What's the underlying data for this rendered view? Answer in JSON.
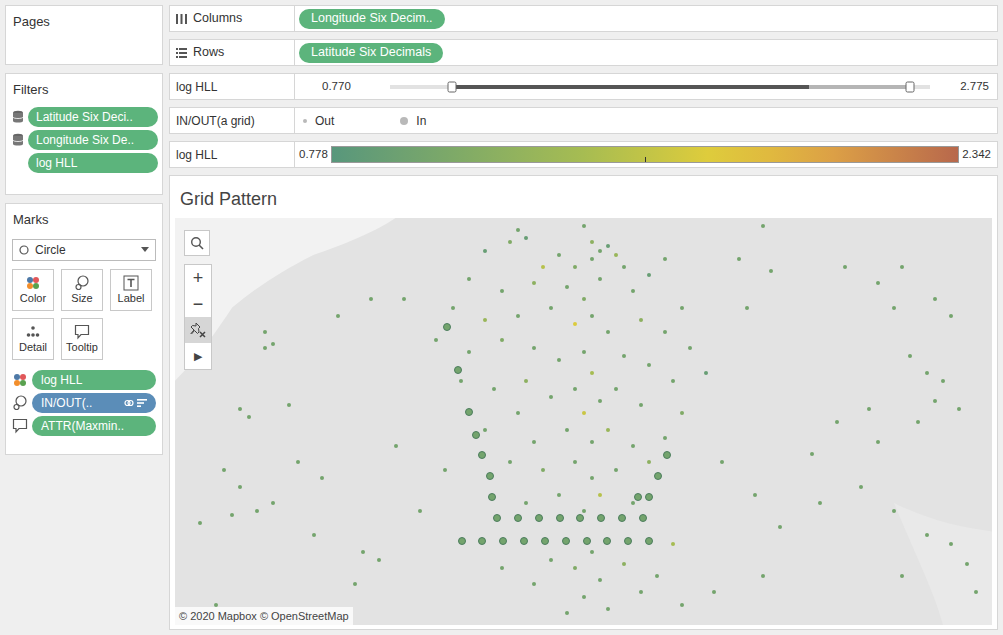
{
  "pages_panel": {
    "title": "Pages"
  },
  "filters_panel": {
    "title": "Filters",
    "items": [
      {
        "label": "Latitude Six Deci..",
        "kind": "db"
      },
      {
        "label": "Longitude Six De..",
        "kind": "db"
      },
      {
        "label": "log HLL",
        "kind": "plain"
      }
    ]
  },
  "marks_panel": {
    "title": "Marks",
    "mark_type": "Circle",
    "buttons": [
      {
        "label": "Color",
        "kind": "color"
      },
      {
        "label": "Size",
        "kind": "size"
      },
      {
        "label": "Label",
        "kind": "label"
      },
      {
        "label": "Detail",
        "kind": "detail"
      },
      {
        "label": "Tooltip",
        "kind": "tooltip"
      }
    ],
    "pills": [
      {
        "label": "log HLL",
        "kind": "color",
        "color": "#5cb47c"
      },
      {
        "label": "IN/OUT(..",
        "kind": "size",
        "color": "#5b8db8"
      },
      {
        "label": "ATTR(Maxmin..",
        "kind": "tooltip",
        "color": "#5cb47c"
      }
    ]
  },
  "shelves": {
    "columns": {
      "title": "Columns",
      "pill": "Longitude Six Decim.."
    },
    "rows": {
      "title": "Rows",
      "pill": "Latitude Six Decimals"
    }
  },
  "filter_card": {
    "title": "log HLL",
    "min": "0.770",
    "max": "2.775",
    "level_low": 0.115,
    "data_high": 0.775,
    "level_high": 0.963
  },
  "size_legend": {
    "title": "IN/OUT(a grid)",
    "items": [
      {
        "label": "Out",
        "kind": "small"
      },
      {
        "label": "In",
        "kind": "large"
      }
    ]
  },
  "color_legend": {
    "title": "log HLL",
    "min": "0.778",
    "max": "2.342",
    "marker_level": 0.5
  },
  "viz": {
    "title": "Grid Pattern",
    "attribution": "© 2020 Mapbox © OpenStreetMap",
    "toolbar": [
      {
        "kind": "search",
        "selected": false
      },
      {
        "kind": "zoom-in",
        "glyph": "+",
        "selected": false
      },
      {
        "kind": "zoom-out",
        "glyph": "−",
        "selected": false
      },
      {
        "kind": "clear-pins",
        "selected": true
      },
      {
        "kind": "expand",
        "glyph": "▶",
        "selected": false
      }
    ],
    "points": [
      [
        0.42,
        0.03,
        1.0
      ],
      [
        0.43,
        0.05,
        0.9
      ],
      [
        0.41,
        0.06,
        1.1
      ],
      [
        0.5,
        0.02,
        1.0
      ],
      [
        0.51,
        0.06,
        1.2
      ],
      [
        0.52,
        0.08,
        1.0
      ],
      [
        0.53,
        0.07,
        0.9
      ],
      [
        0.54,
        0.09,
        1.3
      ],
      [
        0.51,
        0.1,
        1.0
      ],
      [
        0.49,
        0.12,
        1.1
      ],
      [
        0.55,
        0.12,
        1.0
      ],
      [
        0.47,
        0.09,
        1.0
      ],
      [
        0.45,
        0.12,
        1.5
      ],
      [
        0.38,
        0.08,
        0.9
      ],
      [
        0.36,
        0.15,
        1.0
      ],
      [
        0.4,
        0.18,
        1.0
      ],
      [
        0.44,
        0.16,
        1.2
      ],
      [
        0.48,
        0.17,
        1.0
      ],
      [
        0.52,
        0.15,
        1.0
      ],
      [
        0.5,
        0.2,
        1.1
      ],
      [
        0.56,
        0.18,
        1.0
      ],
      [
        0.58,
        0.14,
        0.9
      ],
      [
        0.6,
        0.1,
        1.0
      ],
      [
        0.62,
        0.22,
        1.0
      ],
      [
        0.34,
        0.22,
        1.0
      ],
      [
        0.38,
        0.25,
        1.3
      ],
      [
        0.42,
        0.24,
        1.0
      ],
      [
        0.46,
        0.22,
        1.0
      ],
      [
        0.49,
        0.26,
        1.7
      ],
      [
        0.51,
        0.24,
        1.0
      ],
      [
        0.53,
        0.28,
        1.0
      ],
      [
        0.57,
        0.25,
        1.2
      ],
      [
        0.6,
        0.28,
        1.0
      ],
      [
        0.63,
        0.32,
        1.0
      ],
      [
        0.32,
        0.3,
        1.0
      ],
      [
        0.36,
        0.33,
        1.0
      ],
      [
        0.4,
        0.3,
        1.1
      ],
      [
        0.44,
        0.32,
        1.0
      ],
      [
        0.47,
        0.35,
        1.0
      ],
      [
        0.5,
        0.33,
        1.0
      ],
      [
        0.51,
        0.38,
        1.4
      ],
      [
        0.55,
        0.34,
        1.0
      ],
      [
        0.58,
        0.36,
        1.0
      ],
      [
        0.61,
        0.4,
        1.0
      ],
      [
        0.65,
        0.38,
        0.9
      ],
      [
        0.35,
        0.4,
        1.0
      ],
      [
        0.39,
        0.42,
        1.0
      ],
      [
        0.43,
        0.4,
        1.2
      ],
      [
        0.46,
        0.44,
        1.0
      ],
      [
        0.49,
        0.42,
        1.0
      ],
      [
        0.52,
        0.45,
        1.0
      ],
      [
        0.5,
        0.48,
        1.6
      ],
      [
        0.54,
        0.42,
        1.0
      ],
      [
        0.57,
        0.46,
        1.0
      ],
      [
        0.62,
        0.48,
        1.1
      ],
      [
        0.42,
        0.48,
        1.0
      ],
      [
        0.38,
        0.52,
        1.0
      ],
      [
        0.44,
        0.55,
        1.0
      ],
      [
        0.48,
        0.52,
        1.0
      ],
      [
        0.51,
        0.55,
        1.0
      ],
      [
        0.53,
        0.52,
        1.3
      ],
      [
        0.56,
        0.56,
        1.0
      ],
      [
        0.6,
        0.54,
        1.0
      ],
      [
        0.41,
        0.6,
        1.0
      ],
      [
        0.45,
        0.62,
        1.1
      ],
      [
        0.49,
        0.6,
        1.0
      ],
      [
        0.51,
        0.64,
        1.0
      ],
      [
        0.54,
        0.62,
        1.0
      ],
      [
        0.58,
        0.6,
        1.2
      ],
      [
        0.52,
        0.68,
        1.5
      ],
      [
        0.47,
        0.68,
        1.0
      ],
      [
        0.43,
        0.7,
        1.0
      ],
      [
        0.56,
        0.7,
        1.0
      ],
      [
        0.5,
        0.72,
        1.0
      ],
      [
        0.51,
        0.82,
        1.0
      ],
      [
        0.49,
        0.86,
        1.1
      ],
      [
        0.52,
        0.89,
        1.0
      ],
      [
        0.5,
        0.93,
        1.0
      ],
      [
        0.53,
        0.96,
        1.0
      ],
      [
        0.46,
        0.84,
        1.0
      ],
      [
        0.55,
        0.85,
        1.2
      ],
      [
        0.44,
        0.9,
        1.0
      ],
      [
        0.57,
        0.92,
        1.0
      ],
      [
        0.48,
        0.97,
        1.0
      ],
      [
        0.61,
        0.8,
        1.4
      ],
      [
        0.59,
        0.88,
        1.0
      ],
      [
        0.4,
        0.86,
        1.0
      ],
      [
        0.62,
        0.95,
        1.0
      ],
      [
        0.33,
        0.62,
        1.0
      ],
      [
        0.3,
        0.72,
        1.0
      ],
      [
        0.27,
        0.56,
        1.0
      ],
      [
        0.24,
        0.2,
        1.0
      ],
      [
        0.11,
        0.28,
        1.0
      ],
      [
        0.12,
        0.31,
        1.0
      ],
      [
        0.11,
        0.32,
        1.0
      ],
      [
        0.08,
        0.47,
        1.0
      ],
      [
        0.09,
        0.49,
        1.0
      ],
      [
        0.14,
        0.46,
        1.0
      ],
      [
        0.06,
        0.62,
        1.0
      ],
      [
        0.08,
        0.66,
        1.0
      ],
      [
        0.1,
        0.72,
        1.0
      ],
      [
        0.12,
        0.7,
        1.0
      ],
      [
        0.07,
        0.73,
        1.0
      ],
      [
        0.15,
        0.6,
        1.0
      ],
      [
        0.18,
        0.64,
        1.0
      ],
      [
        0.17,
        0.78,
        1.0
      ],
      [
        0.23,
        0.82,
        1.0
      ],
      [
        0.25,
        0.84,
        1.0
      ],
      [
        0.03,
        0.75,
        1.0
      ],
      [
        0.2,
        0.24,
        1.0
      ],
      [
        0.28,
        0.2,
        1.0
      ],
      [
        0.22,
        0.9,
        1.0
      ],
      [
        0.05,
        0.95,
        1.0
      ],
      [
        0.69,
        0.1,
        1.0
      ],
      [
        0.72,
        0.02,
        1.0
      ],
      [
        0.73,
        0.13,
        1.0
      ],
      [
        0.7,
        0.22,
        1.0
      ],
      [
        0.82,
        0.12,
        1.0
      ],
      [
        0.86,
        0.16,
        1.0
      ],
      [
        0.89,
        0.12,
        1.0
      ],
      [
        0.93,
        0.2,
        1.0
      ],
      [
        0.88,
        0.22,
        1.0
      ],
      [
        0.95,
        0.24,
        1.0
      ],
      [
        0.9,
        0.34,
        1.0
      ],
      [
        0.92,
        0.38,
        1.0
      ],
      [
        0.94,
        0.4,
        1.0
      ],
      [
        0.93,
        0.45,
        1.0
      ],
      [
        0.96,
        0.47,
        1.0
      ],
      [
        0.91,
        0.5,
        1.0
      ],
      [
        0.85,
        0.47,
        1.0
      ],
      [
        0.86,
        0.55,
        1.0
      ],
      [
        0.81,
        0.5,
        1.0
      ],
      [
        0.78,
        0.58,
        1.0
      ],
      [
        0.84,
        0.66,
        1.0
      ],
      [
        0.79,
        0.7,
        1.0
      ],
      [
        0.88,
        0.72,
        1.0
      ],
      [
        0.92,
        0.78,
        1.0
      ],
      [
        0.95,
        0.8,
        1.0
      ],
      [
        0.97,
        0.85,
        1.0
      ],
      [
        0.89,
        0.88,
        1.0
      ],
      [
        0.74,
        0.76,
        1.0
      ],
      [
        0.71,
        0.68,
        1.0
      ],
      [
        0.67,
        0.6,
        1.0
      ],
      [
        0.72,
        0.88,
        1.0
      ],
      [
        0.66,
        0.92,
        1.0
      ],
      [
        0.98,
        0.92,
        1.0
      ]
    ],
    "in_points": [
      [
        0.333,
        0.269,
        1.0
      ],
      [
        0.346,
        0.373,
        1.0
      ],
      [
        0.36,
        0.477,
        1.0
      ],
      [
        0.368,
        0.533,
        1.0
      ],
      [
        0.376,
        0.583,
        1.0
      ],
      [
        0.385,
        0.635,
        1.0
      ],
      [
        0.388,
        0.686,
        1.0
      ],
      [
        0.394,
        0.738,
        1.0
      ],
      [
        0.351,
        0.793,
        1.0
      ],
      [
        0.376,
        0.793,
        1.0
      ],
      [
        0.402,
        0.793,
        1.0
      ],
      [
        0.427,
        0.793,
        1.0
      ],
      [
        0.453,
        0.793,
        1.0
      ],
      [
        0.478,
        0.793,
        1.0
      ],
      [
        0.504,
        0.793,
        1.0
      ],
      [
        0.529,
        0.793,
        1.0
      ],
      [
        0.555,
        0.793,
        1.0
      ],
      [
        0.58,
        0.793,
        1.0
      ],
      [
        0.42,
        0.738,
        1.0
      ],
      [
        0.445,
        0.738,
        1.0
      ],
      [
        0.471,
        0.738,
        1.0
      ],
      [
        0.496,
        0.738,
        1.0
      ],
      [
        0.522,
        0.738,
        1.0
      ],
      [
        0.547,
        0.738,
        1.0
      ],
      [
        0.573,
        0.738,
        1.0
      ],
      [
        0.602,
        0.583,
        1.0
      ],
      [
        0.591,
        0.635,
        1.0
      ],
      [
        0.58,
        0.686,
        1.0
      ],
      [
        0.567,
        0.686,
        1.0
      ]
    ]
  }
}
